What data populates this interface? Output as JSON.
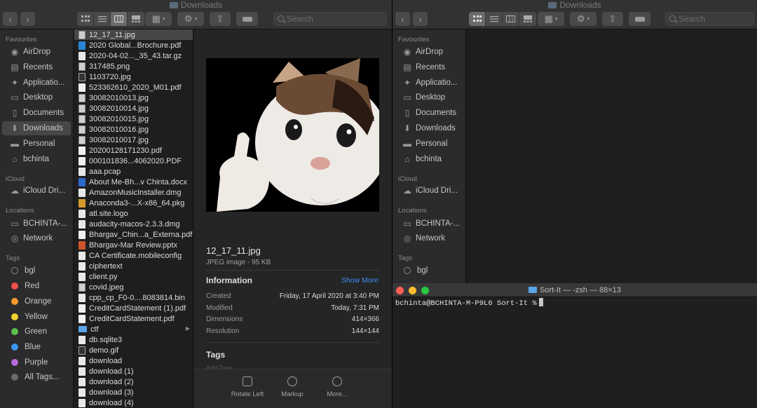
{
  "left_finder": {
    "title": "Downloads",
    "search_placeholder": "Search",
    "sidebar": {
      "favourites_header": "Favourites",
      "favourites": [
        {
          "label": "AirDrop",
          "icon": "airdrop-icon"
        },
        {
          "label": "Recents",
          "icon": "clock-icon"
        },
        {
          "label": "Applicatio...",
          "icon": "applications-icon"
        },
        {
          "label": "Desktop",
          "icon": "desktop-icon"
        },
        {
          "label": "Documents",
          "icon": "document-icon"
        },
        {
          "label": "Downloads",
          "icon": "download-icon"
        },
        {
          "label": "Personal",
          "icon": "folder-icon"
        },
        {
          "label": "bchinta",
          "icon": "home-icon"
        }
      ],
      "icloud_header": "iCloud",
      "icloud": [
        {
          "label": "iCloud Dri...",
          "icon": "cloud-icon"
        }
      ],
      "locations_header": "Locations",
      "locations": [
        {
          "label": "BCHINTA-...",
          "icon": "computer-icon"
        },
        {
          "label": "Network",
          "icon": "network-icon"
        }
      ],
      "tags_header": "Tags",
      "tags": [
        {
          "label": "bgl",
          "color": "#3a3a3a"
        },
        {
          "label": "Red",
          "color": "#f0504a"
        },
        {
          "label": "Orange",
          "color": "#f49a2a"
        },
        {
          "label": "Yellow",
          "color": "#f2d22e"
        },
        {
          "label": "Green",
          "color": "#5ac148"
        },
        {
          "label": "Blue",
          "color": "#3a97ef"
        },
        {
          "label": "Purple",
          "color": "#b86ad6"
        },
        {
          "label": "All Tags...",
          "color": "#6a6a6a"
        }
      ]
    },
    "files": [
      {
        "name": "12_17_11.jpg",
        "kind": "img"
      },
      {
        "name": "2020 Global...Brochure.pdf",
        "kind": "pdf"
      },
      {
        "name": "2020-04-02..._35_43.tar.gz",
        "kind": "file"
      },
      {
        "name": "317485.png",
        "kind": "img"
      },
      {
        "name": "1103720.jpg",
        "kind": "dark"
      },
      {
        "name": "523362610_2020_M01.pdf",
        "kind": "pdf"
      },
      {
        "name": "30082010013.jpg",
        "kind": "img"
      },
      {
        "name": "30082010014.jpg",
        "kind": "img"
      },
      {
        "name": "30082010015.jpg",
        "kind": "img"
      },
      {
        "name": "30082010016.jpg",
        "kind": "img"
      },
      {
        "name": "30082010017.jpg",
        "kind": "img"
      },
      {
        "name": "20200128171230.pdf",
        "kind": "pdf"
      },
      {
        "name": "000101836...4062020.PDF",
        "kind": "pdf"
      },
      {
        "name": "aaa.pcap",
        "kind": "file"
      },
      {
        "name": "About Me-Bh...v Chinta.docx",
        "kind": "doc"
      },
      {
        "name": "AmazonMusicInstaller.dmg",
        "kind": "file"
      },
      {
        "name": "Anaconda3-...X-x86_64.pkg",
        "kind": "pkg"
      },
      {
        "name": "atl.site.logo",
        "kind": "file"
      },
      {
        "name": "audacity-macos-2.3.3.dmg",
        "kind": "file"
      },
      {
        "name": "Bhargav_Chin...a_Externa.pdf",
        "kind": "pdf"
      },
      {
        "name": "Bhargav-Mar Review.pptx",
        "kind": "ppt"
      },
      {
        "name": "CA Certificate.mobileconfig",
        "kind": "file"
      },
      {
        "name": "ciphertext",
        "kind": "file"
      },
      {
        "name": "client.py",
        "kind": "file"
      },
      {
        "name": "covid.jpeg",
        "kind": "img"
      },
      {
        "name": "cpp_cp_F0-0....8083814.bin",
        "kind": "file"
      },
      {
        "name": "CreditCardStatement (1).pdf",
        "kind": "pdf"
      },
      {
        "name": "CreditCardStatement.pdf",
        "kind": "pdf"
      },
      {
        "name": "ctf",
        "kind": "folder"
      },
      {
        "name": "db.sqlite3",
        "kind": "file"
      },
      {
        "name": "demo.gif",
        "kind": "dark"
      },
      {
        "name": "download",
        "kind": "file"
      },
      {
        "name": "download (1)",
        "kind": "file"
      },
      {
        "name": "download (2)",
        "kind": "file"
      },
      {
        "name": "download (3)",
        "kind": "file"
      },
      {
        "name": "download (4)",
        "kind": "file"
      }
    ],
    "preview": {
      "filename": "12_17_11.jpg",
      "kind": "JPEG image - 95 KB",
      "info_header": "Information",
      "show_more": "Show More",
      "info": [
        {
          "key": "Created",
          "value": "Friday, 17 April 2020 at 3:40 PM"
        },
        {
          "key": "Modified",
          "value": "Today, 7:31 PM"
        },
        {
          "key": "Dimensions",
          "value": "414×366"
        },
        {
          "key": "Resolution",
          "value": "144×144"
        }
      ],
      "tags_header": "Tags",
      "add_tags": "Add Tags...",
      "actions": [
        {
          "label": "Rotate Left",
          "icon": "rotate-left-icon"
        },
        {
          "label": "Markup",
          "icon": "markup-icon"
        },
        {
          "label": "More...",
          "icon": "more-icon"
        }
      ]
    }
  },
  "right_finder": {
    "title": "Downloads",
    "search_placeholder": "Search",
    "sidebar": {
      "favourites_header": "Favourites",
      "favourites": [
        {
          "label": "AirDrop"
        },
        {
          "label": "Recents"
        },
        {
          "label": "Applicatio..."
        },
        {
          "label": "Desktop"
        },
        {
          "label": "Documents"
        },
        {
          "label": "Downloads"
        },
        {
          "label": "Personal"
        },
        {
          "label": "bchinta"
        }
      ],
      "icloud_header": "iCloud",
      "icloud": [
        {
          "label": "iCloud Dri..."
        }
      ],
      "locations_header": "Locations",
      "locations": [
        {
          "label": "BCHINTA-..."
        },
        {
          "label": "Network"
        }
      ],
      "tags_header": "Tags",
      "tags": [
        {
          "label": "bgl",
          "color": "#3a3a3a"
        }
      ]
    }
  },
  "terminal": {
    "title": "Sort-It — -zsh — 88×13",
    "prompt": "bchinta@BCHINTA-M-P9L6 Sort-It %"
  }
}
